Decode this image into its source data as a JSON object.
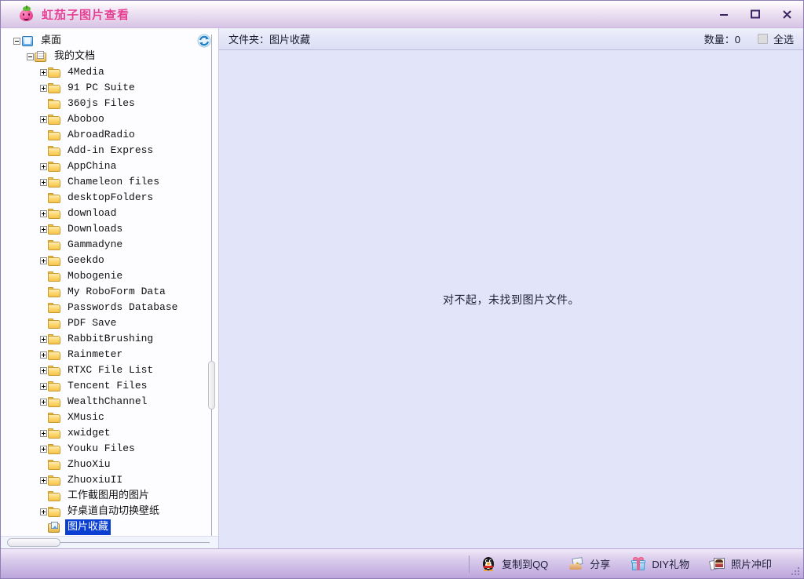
{
  "window": {
    "title": "虹茄子图片查看",
    "app_icon": "tomato-icon",
    "minimize_label": "最小化",
    "maximize_label": "最大化",
    "close_label": "关闭"
  },
  "tree_panel": {
    "refresh_icon": "refresh-icon",
    "nodes": [
      {
        "label": "桌面",
        "depth": 0,
        "icon": "desktop-icon",
        "twist": "minus",
        "selected": false
      },
      {
        "label": "我的文档",
        "depth": 1,
        "icon": "documents-icon",
        "twist": "minus",
        "selected": false
      },
      {
        "label": "4Media",
        "depth": 2,
        "icon": "folder-icon",
        "twist": "plus",
        "selected": false
      },
      {
        "label": "91 PC Suite",
        "depth": 2,
        "icon": "folder-icon",
        "twist": "plus",
        "selected": false
      },
      {
        "label": "360js Files",
        "depth": 2,
        "icon": "folder-icon",
        "twist": "none",
        "selected": false
      },
      {
        "label": "Aboboo",
        "depth": 2,
        "icon": "folder-icon",
        "twist": "plus",
        "selected": false
      },
      {
        "label": "AbroadRadio",
        "depth": 2,
        "icon": "folder-icon",
        "twist": "none",
        "selected": false
      },
      {
        "label": "Add-in Express",
        "depth": 2,
        "icon": "folder-icon",
        "twist": "none",
        "selected": false
      },
      {
        "label": "AppChina",
        "depth": 2,
        "icon": "folder-icon",
        "twist": "plus",
        "selected": false
      },
      {
        "label": "Chameleon files",
        "depth": 2,
        "icon": "folder-icon",
        "twist": "plus",
        "selected": false
      },
      {
        "label": "desktopFolders",
        "depth": 2,
        "icon": "folder-icon",
        "twist": "none",
        "selected": false
      },
      {
        "label": "download",
        "depth": 2,
        "icon": "folder-icon",
        "twist": "plus",
        "selected": false
      },
      {
        "label": "Downloads",
        "depth": 2,
        "icon": "folder-icon",
        "twist": "plus",
        "selected": false
      },
      {
        "label": "Gammadyne",
        "depth": 2,
        "icon": "folder-icon",
        "twist": "none",
        "selected": false
      },
      {
        "label": "Geekdo",
        "depth": 2,
        "icon": "folder-icon",
        "twist": "plus",
        "selected": false
      },
      {
        "label": "Mobogenie",
        "depth": 2,
        "icon": "folder-icon",
        "twist": "none",
        "selected": false
      },
      {
        "label": "My RoboForm Data",
        "depth": 2,
        "icon": "folder-icon",
        "twist": "none",
        "selected": false
      },
      {
        "label": "Passwords Database",
        "depth": 2,
        "icon": "folder-icon",
        "twist": "none",
        "selected": false
      },
      {
        "label": "PDF Save",
        "depth": 2,
        "icon": "folder-icon",
        "twist": "none",
        "selected": false
      },
      {
        "label": "RabbitBrushing",
        "depth": 2,
        "icon": "folder-icon",
        "twist": "plus",
        "selected": false
      },
      {
        "label": "Rainmeter",
        "depth": 2,
        "icon": "folder-icon",
        "twist": "plus",
        "selected": false
      },
      {
        "label": "RTXC File List",
        "depth": 2,
        "icon": "folder-icon",
        "twist": "plus",
        "selected": false
      },
      {
        "label": "Tencent Files",
        "depth": 2,
        "icon": "folder-icon",
        "twist": "plus",
        "selected": false
      },
      {
        "label": "WealthChannel",
        "depth": 2,
        "icon": "folder-icon",
        "twist": "plus",
        "selected": false
      },
      {
        "label": "XMusic",
        "depth": 2,
        "icon": "folder-icon",
        "twist": "none",
        "selected": false
      },
      {
        "label": "xwidget",
        "depth": 2,
        "icon": "folder-icon",
        "twist": "plus",
        "selected": false
      },
      {
        "label": "Youku Files",
        "depth": 2,
        "icon": "folder-icon",
        "twist": "plus",
        "selected": false
      },
      {
        "label": "ZhuoXiu",
        "depth": 2,
        "icon": "folder-icon",
        "twist": "none",
        "selected": false
      },
      {
        "label": "ZhuoxiuII",
        "depth": 2,
        "icon": "folder-icon",
        "twist": "plus",
        "selected": false
      },
      {
        "label": "工作截图用的图片",
        "depth": 2,
        "icon": "folder-icon",
        "twist": "none",
        "selected": false
      },
      {
        "label": "好桌道自动切换壁纸",
        "depth": 2,
        "icon": "folder-icon",
        "twist": "plus",
        "selected": false
      },
      {
        "label": "图片收藏",
        "depth": 2,
        "icon": "picture-folder-icon",
        "twist": "none",
        "selected": true
      }
    ]
  },
  "content_header": {
    "folder_label": "文件夹：图片收藏",
    "count_label": "数量：0",
    "select_all_label": "全选",
    "select_all_checked": false
  },
  "content": {
    "empty_message": "对不起，未找到图片文件。"
  },
  "bottom_bar": {
    "items": [
      {
        "label": "复制到QQ",
        "icon": "qq-penguin-icon"
      },
      {
        "label": "分享",
        "icon": "share-icon"
      },
      {
        "label": "DIY礼物",
        "icon": "gift-icon"
      },
      {
        "label": "照片冲印",
        "icon": "photo-print-icon"
      }
    ]
  },
  "colors": {
    "title_text": "#e33f95",
    "content_bg": "#e2e4fa",
    "selection": "#0a3fd1",
    "bottom_bar": "#c8b4e2",
    "folder_yellow": "#f5c24a"
  }
}
